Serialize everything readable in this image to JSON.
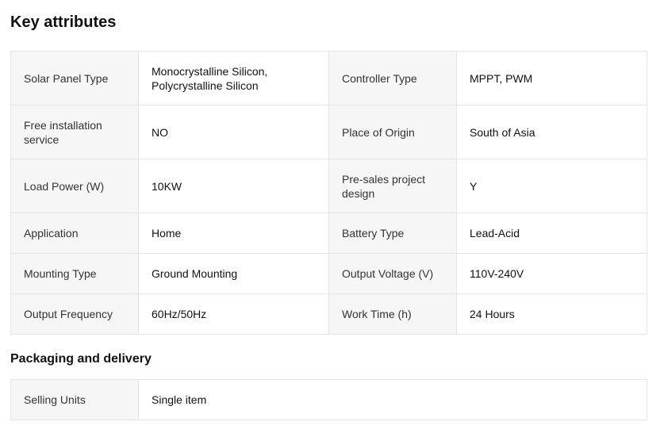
{
  "key_attributes": {
    "title": "Key attributes",
    "rows": [
      [
        {
          "label": "Solar Panel Type",
          "value": "Monocrystalline Silicon, Polycrystalline Silicon"
        },
        {
          "label": "Controller Type",
          "value": "MPPT, PWM"
        }
      ],
      [
        {
          "label": "Free installation service",
          "value": "NO"
        },
        {
          "label": "Place of Origin",
          "value": "South of Asia"
        }
      ],
      [
        {
          "label": "Load Power (W)",
          "value": "10KW"
        },
        {
          "label": "Pre-sales project design",
          "value": "Y"
        }
      ],
      [
        {
          "label": "Application",
          "value": "Home"
        },
        {
          "label": "Battery Type",
          "value": "Lead-Acid"
        }
      ],
      [
        {
          "label": "Mounting Type",
          "value": "Ground Mounting"
        },
        {
          "label": "Output Voltage (V)",
          "value": "110V-240V"
        }
      ],
      [
        {
          "label": "Output Frequency",
          "value": "60Hz/50Hz"
        },
        {
          "label": "Work Time (h)",
          "value": "24 Hours"
        }
      ]
    ]
  },
  "packaging": {
    "title": "Packaging and delivery",
    "rows": [
      {
        "label": "Selling Units",
        "value": "Single item"
      }
    ]
  }
}
